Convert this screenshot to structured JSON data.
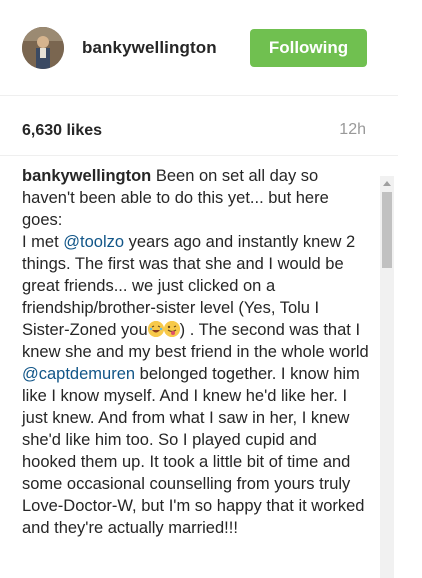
{
  "post": {
    "username": "bankywellington",
    "follow_label": "Following",
    "likes": "6,630 likes",
    "time": "12h",
    "caption": {
      "author": "bankywellington",
      "part1": " Been on set all day so haven't been able to do this yet... but here goes:\nI met ",
      "mention1": "@toolzo",
      "part2": " years ago and instantly knew 2 things. The first was that she and I would be great friends... we just clicked on a friendship/brother-sister level (Yes, Tolu I Sister-Zoned you",
      "part3": ") . The second was that I knew she and my best friend in the whole world ",
      "mention2": "@captdemuren",
      "part4": " belonged together. I know him like I know myself. And I knew he'd like her. I just knew. And from what I saw in her, I knew she'd like him too. So I played cupid and hooked them up. It took a little bit of time and some occasional counselling from yours truly Love-Doctor-W, but I'm so happy that it worked and they're actually married!!!"
    }
  },
  "colors": {
    "follow_button": "#70c050",
    "mention": "#125688",
    "muted": "#999999"
  },
  "icons": {
    "emoji_1": "laughing-emoji-icon",
    "emoji_2": "tongue-wink-emoji-icon"
  }
}
